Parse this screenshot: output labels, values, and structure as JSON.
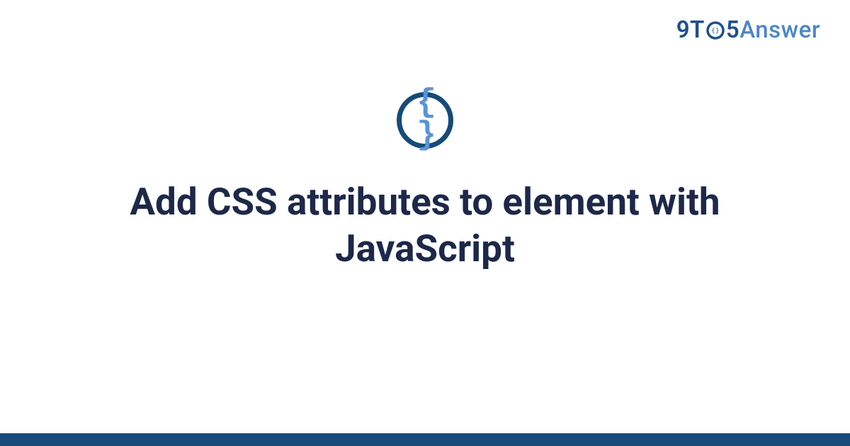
{
  "brand": {
    "nine": "9",
    "t": "T",
    "five": "5",
    "answer": "Answer"
  },
  "badge": {
    "glyph": "{ }"
  },
  "title": "Add CSS attributes to element with JavaScript",
  "colors": {
    "brand_dark": "#1d4f8c",
    "brand_light": "#4d86c6",
    "title_color": "#1d284a",
    "badge_ring": "#154a7a",
    "badge_brace": "#5a94d6",
    "footer": "#174b7b"
  }
}
